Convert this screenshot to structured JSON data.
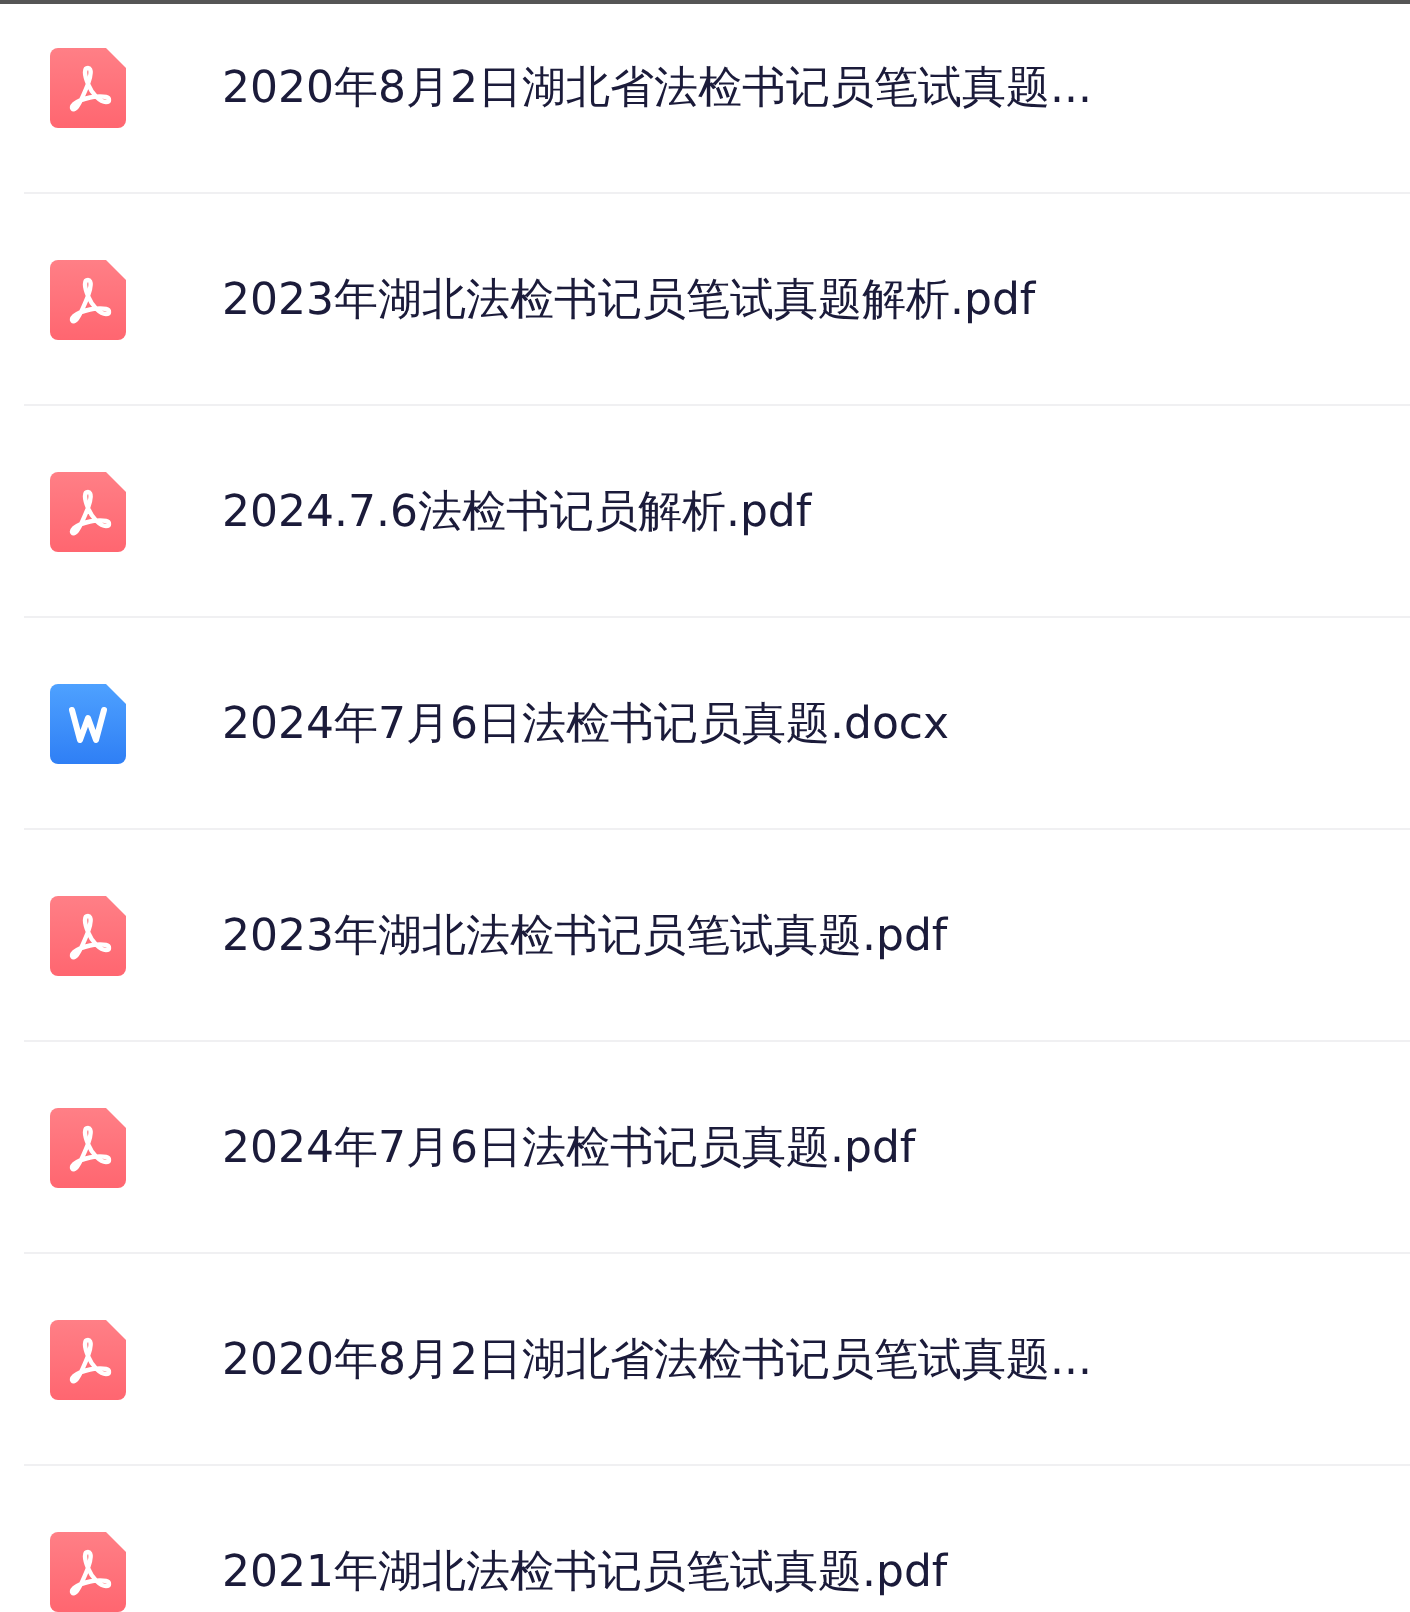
{
  "files": [
    {
      "kind": "pdf",
      "name": "2020年8月2日湖北省法检书记员笔试真题..."
    },
    {
      "kind": "pdf",
      "name": "2023年湖北法检书记员笔试真题解析.pdf"
    },
    {
      "kind": "pdf",
      "name": "2024.7.6法检书记员解析.pdf"
    },
    {
      "kind": "docx",
      "name": "2024年7月6日法检书记员真题.docx"
    },
    {
      "kind": "pdf",
      "name": "2023年湖北法检书记员笔试真题.pdf"
    },
    {
      "kind": "pdf",
      "name": "2024年7月6日法检书记员真题.pdf"
    },
    {
      "kind": "pdf",
      "name": "2020年8月2日湖北省法检书记员笔试真题..."
    },
    {
      "kind": "pdf",
      "name": "2021年湖北法检书记员笔试真题.pdf"
    }
  ]
}
